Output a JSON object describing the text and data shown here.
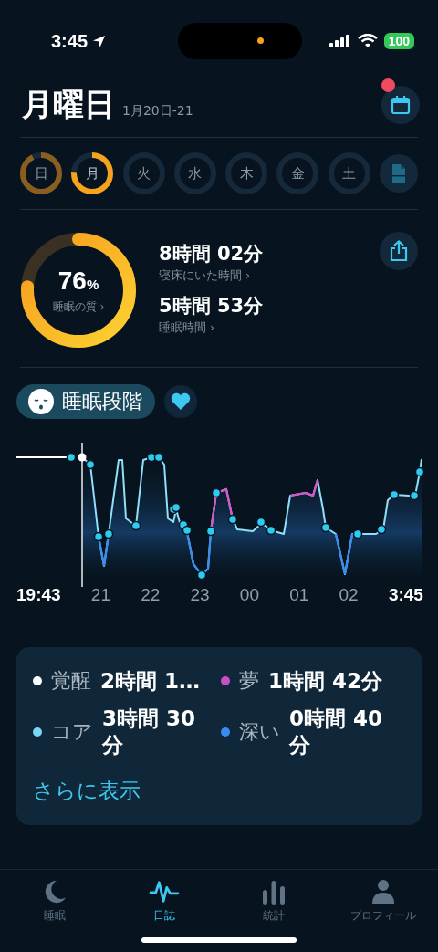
{
  "status_bar": {
    "time": "3:45",
    "battery": "100"
  },
  "header": {
    "title": "月曜日",
    "date": "1月20日-21",
    "calendar_badge": true
  },
  "days": [
    {
      "label": "日",
      "level": 0.92,
      "selected": false
    },
    {
      "label": "月",
      "level": 0.76,
      "selected": true
    },
    {
      "label": "火",
      "level": 0,
      "selected": false
    },
    {
      "label": "水",
      "level": 0,
      "selected": false
    },
    {
      "label": "木",
      "level": 0,
      "selected": false
    },
    {
      "label": "金",
      "level": 0,
      "selected": false
    },
    {
      "label": "土",
      "level": 0,
      "selected": false
    }
  ],
  "score": {
    "value": "76",
    "unit": "%",
    "label": "睡眠の質 ›",
    "level": 0.76
  },
  "stats": [
    {
      "value": "8時間 02分",
      "label": "寝床にいた時間 ›"
    },
    {
      "value": "5時間 53分",
      "label": "睡眠時間 ›"
    }
  ],
  "section": {
    "title": "睡眠段階"
  },
  "chart_axis": {
    "start": "19:43",
    "ticks": [
      "21",
      "22",
      "23",
      "00",
      "01",
      "02"
    ],
    "end": "3:45"
  },
  "legend": [
    {
      "name": "覚醒",
      "value": "2時間 1…",
      "color": "#ffffff"
    },
    {
      "name": "夢",
      "value": "1時間 42分",
      "color": "#c84fc4"
    },
    {
      "name": "コア",
      "value": "3時間 30分",
      "color": "#7ad6f4"
    },
    {
      "name": "深い",
      "value": "0時間 40分",
      "color": "#3a8cf0"
    }
  ],
  "more_link": "さらに表示",
  "tabs": [
    {
      "label": "睡眠",
      "kind": "moon",
      "selected": false
    },
    {
      "label": "日誌",
      "kind": "wave",
      "selected": true
    },
    {
      "label": "統計",
      "kind": "bars",
      "selected": false
    },
    {
      "label": "プロフィール",
      "kind": "person",
      "selected": false
    }
  ]
}
